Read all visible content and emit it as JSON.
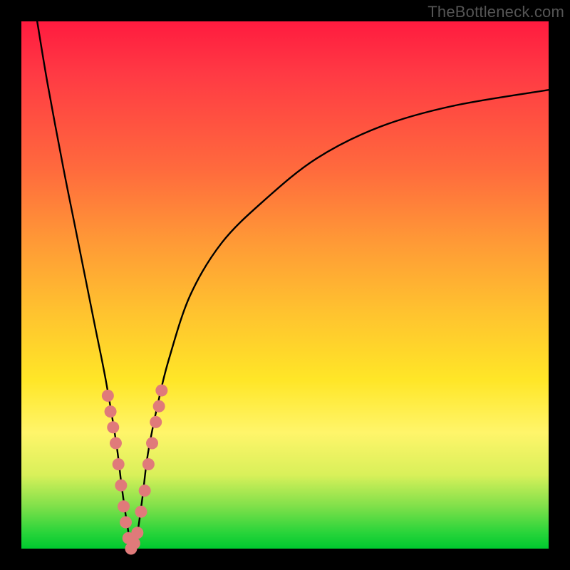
{
  "watermark": "TheBottleneck.com",
  "chart_data": {
    "type": "line",
    "title": "",
    "xlabel": "",
    "ylabel": "",
    "xlim": [
      0,
      100
    ],
    "ylim": [
      0,
      100
    ],
    "grid": false,
    "legend": false,
    "series": [
      {
        "name": "bottleneck-curve",
        "color": "#000000",
        "x": [
          3,
          5,
          8,
          10,
          12,
          14,
          16,
          18,
          19,
          20,
          21,
          22,
          23,
          24,
          26,
          28,
          32,
          38,
          46,
          56,
          68,
          82,
          100
        ],
        "y": [
          100,
          88,
          72,
          62,
          52,
          42,
          32,
          20,
          12,
          5,
          0,
          3,
          10,
          18,
          28,
          36,
          48,
          58,
          66,
          74,
          80,
          84,
          87
        ]
      },
      {
        "name": "highlight-dots",
        "color": "#e07a7a",
        "type": "scatter",
        "x": [
          16.4,
          16.9,
          17.4,
          17.9,
          18.4,
          18.9,
          19.4,
          19.8,
          20.3,
          20.8,
          21.4,
          22.0,
          22.7,
          23.4,
          24.1,
          24.8,
          25.5,
          26.1,
          26.6
        ],
        "y": [
          29,
          26,
          23,
          20,
          16,
          12,
          8,
          5,
          2,
          0,
          1,
          3,
          7,
          11,
          16,
          20,
          24,
          27,
          30
        ]
      }
    ],
    "background_gradient": {
      "direction": "vertical",
      "stops": [
        {
          "pos": 0.0,
          "color": "#ff1b3f"
        },
        {
          "pos": 0.28,
          "color": "#ff6a3d"
        },
        {
          "pos": 0.55,
          "color": "#ffc22f"
        },
        {
          "pos": 0.78,
          "color": "#fff56a"
        },
        {
          "pos": 0.92,
          "color": "#7fe04a"
        },
        {
          "pos": 1.0,
          "color": "#00c92f"
        }
      ]
    }
  }
}
